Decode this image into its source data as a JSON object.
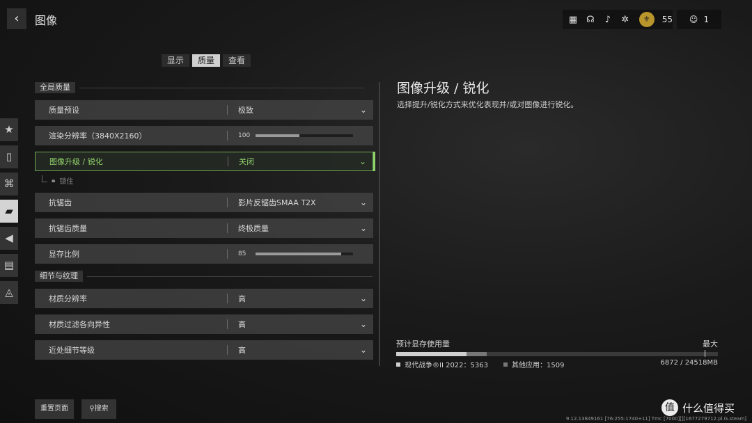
{
  "header": {
    "back_icon": "chevron-left-icon",
    "title": "图像",
    "icons": [
      "grid-icon",
      "headset-icon",
      "bell-icon",
      "gear-icon"
    ],
    "level": "55",
    "party_count": "1"
  },
  "tabs": [
    {
      "label": "显示",
      "active": false
    },
    {
      "label": "质量",
      "active": true
    },
    {
      "label": "查看",
      "active": false
    }
  ],
  "side_nav": [
    "star-icon",
    "mouse-icon",
    "gamepad-icon",
    "display-icon",
    "speaker-icon",
    "interface-icon",
    "network-icon"
  ],
  "sections": {
    "global": "全局质量",
    "detail": "细节与纹理"
  },
  "rows": [
    {
      "name": "质量预设",
      "value": "极致"
    },
    {
      "name": "渲染分辨率（3840X2160）",
      "value": "100",
      "level": 0.45
    },
    {
      "name": "图像升级 / 锐化",
      "value": "关闭"
    },
    {
      "name": "抗锯齿",
      "value": "影片反锯齿SMAA T2X"
    },
    {
      "name": "抗锯齿质量",
      "value": "终极质量"
    },
    {
      "name": "显存比例",
      "value": "85",
      "level": 0.88
    },
    {
      "name": "材质分辨率",
      "value": "高"
    },
    {
      "name": "材质过滤各向异性",
      "value": "高"
    },
    {
      "name": "近处细节等级",
      "value": "高"
    }
  ],
  "locked_sub": "锁住",
  "detail_panel": {
    "title": "图像升级 / 锐化",
    "description": "选择提升/锐化方式来优化表现并/或对图像进行锐化。"
  },
  "vram": {
    "label": "预计显存使用量",
    "max_label": "最大",
    "game": "现代战争®II 2022：5363",
    "other": "其他应用：1509",
    "total": "6872 / 24518MB",
    "game_fraction": 0.219,
    "other_fraction": 0.062
  },
  "bottom": {
    "reset": "重置页面",
    "search": "搜索"
  },
  "build_info": "9.12.13849161 [76:255:1740+11] Tmc [7000][][1677279712.pl.G.steam]",
  "watermark": "什么值得买"
}
